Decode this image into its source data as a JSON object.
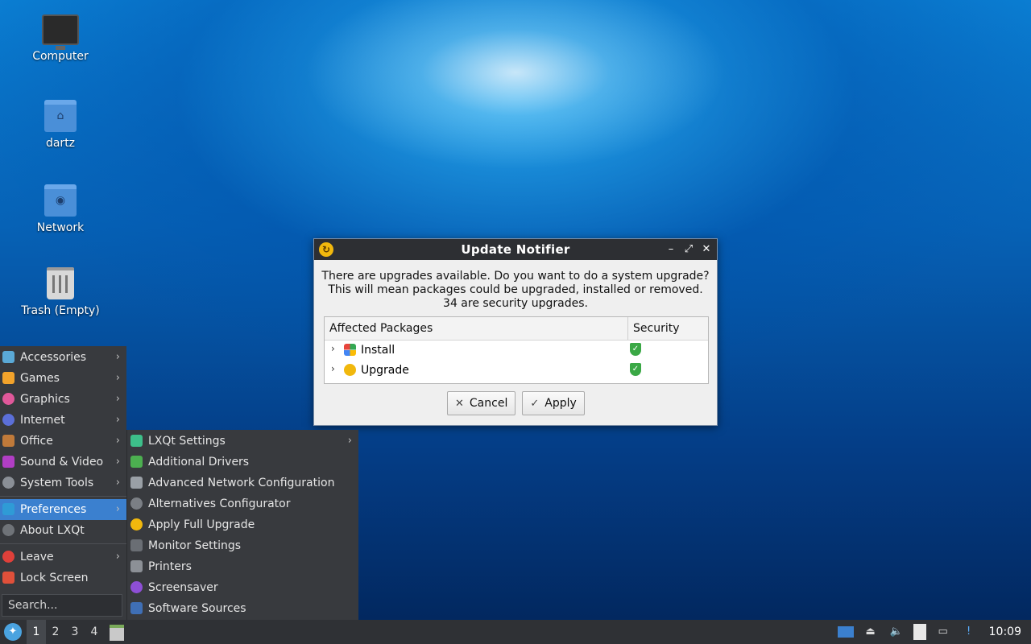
{
  "desktop": {
    "icons": [
      {
        "label": "Computer",
        "icon": "computer-icon"
      },
      {
        "label": "dartz",
        "icon": "home-folder-icon"
      },
      {
        "label": "Network",
        "icon": "network-folder-icon"
      },
      {
        "label": "Trash (Empty)",
        "icon": "trash-icon"
      }
    ]
  },
  "dialog": {
    "title": "Update Notifier",
    "message_lines": [
      "There are upgrades available. Do you want to do a system upgrade?",
      "This will mean packages could be upgraded, installed or removed.",
      "34 are security upgrades."
    ],
    "table": {
      "headers": [
        "Affected Packages",
        "Security"
      ],
      "rows": [
        {
          "label": "Install",
          "icon": "install-icon",
          "security": "shield-check-icon"
        },
        {
          "label": "Upgrade",
          "icon": "upgrade-icon",
          "security": "shield-check-icon"
        }
      ]
    },
    "buttons": {
      "cancel": "Cancel",
      "apply": "Apply"
    }
  },
  "start_menu": {
    "items": [
      {
        "label": "Accessories",
        "submenu": true
      },
      {
        "label": "Games",
        "submenu": true
      },
      {
        "label": "Graphics",
        "submenu": true
      },
      {
        "label": "Internet",
        "submenu": true
      },
      {
        "label": "Office",
        "submenu": true
      },
      {
        "label": "Sound & Video",
        "submenu": true
      },
      {
        "label": "System Tools",
        "submenu": true
      },
      {
        "label": "Preferences",
        "submenu": true,
        "active": true
      },
      {
        "label": "About LXQt",
        "submenu": false
      },
      {
        "label": "Leave",
        "submenu": true
      },
      {
        "label": "Lock Screen",
        "submenu": false
      }
    ],
    "search_placeholder": "Search..."
  },
  "preferences_submenu": {
    "items": [
      {
        "label": "LXQt Settings",
        "submenu": true
      },
      {
        "label": "Additional Drivers"
      },
      {
        "label": "Advanced Network Configuration"
      },
      {
        "label": "Alternatives Configurator"
      },
      {
        "label": "Apply Full Upgrade"
      },
      {
        "label": "Monitor Settings"
      },
      {
        "label": "Printers"
      },
      {
        "label": "Screensaver"
      },
      {
        "label": "Software Sources"
      }
    ]
  },
  "taskbar": {
    "desktops": [
      "1",
      "2",
      "3",
      "4"
    ],
    "current_desktop": "1",
    "clock": "10:09"
  },
  "colors": {
    "accent": "#3b80cf",
    "menu_bg": "#383a3e",
    "titlebar": "#2d2f33",
    "dialog_bg": "#efefef",
    "security_green": "#3aa845"
  }
}
